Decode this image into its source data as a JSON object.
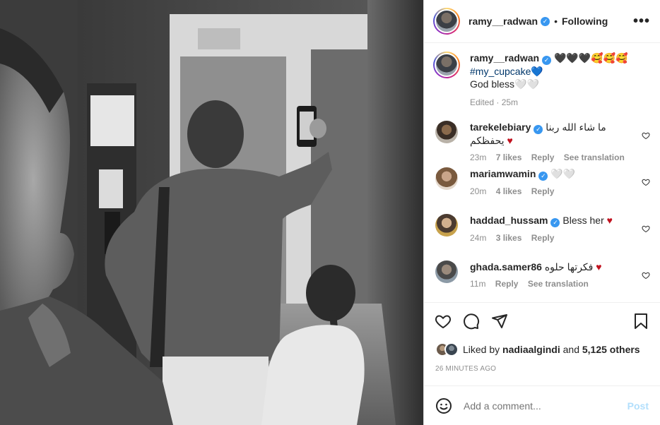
{
  "post": {
    "author": "ramy__radwan",
    "follow_state": "Following",
    "separator": "•",
    "more_label": "•••",
    "verified_mark": "✓"
  },
  "caption": {
    "username": "ramy__radwan",
    "emojis": "🖤🖤🖤🥰🥰🥰",
    "hashtag": "#my_cupcake",
    "hashtag_suffix": "💙",
    "line2": "God bless🤍🤍",
    "meta": "Edited · 25m"
  },
  "comments": [
    {
      "username": "tarekelebiary",
      "text": "ما شاء الله ربنا يحفظكم",
      "suffix": "♥",
      "time": "23m",
      "likes": "7 likes",
      "reply": "Reply",
      "extra": "See translation"
    },
    {
      "username": "mariamwamin",
      "text": "🤍🤍",
      "suffix": "",
      "time": "20m",
      "likes": "4 likes",
      "reply": "Reply",
      "extra": ""
    },
    {
      "username": "haddad_hussam",
      "text": "Bless her",
      "suffix": "♥",
      "time": "24m",
      "likes": "3 likes",
      "reply": "Reply",
      "extra": ""
    },
    {
      "username": "ghada.samer86",
      "text": "فكرتها حلوه",
      "suffix": "♥",
      "time": "11m",
      "likes": "",
      "reply": "Reply",
      "extra": "See translation"
    }
  ],
  "likes": {
    "prefix": "Liked by",
    "first_liker": "nadiaalgindi",
    "and": "and",
    "others": "5,125 others"
  },
  "timestamp": "26 MINUTES AGO",
  "composer": {
    "placeholder": "Add a comment...",
    "post_label": "Post"
  },
  "icons": {
    "like": "heart-icon",
    "comment": "comment-icon",
    "share": "paper-plane-icon",
    "save": "bookmark-icon",
    "emoji": "smiley-icon",
    "more": "ellipsis-icon"
  },
  "colors": {
    "verified": "#3897f0",
    "hashtag": "#00376b",
    "heart": "#c1121f",
    "muted": "#8e8e8e",
    "post_disabled": "#b2dffc"
  }
}
